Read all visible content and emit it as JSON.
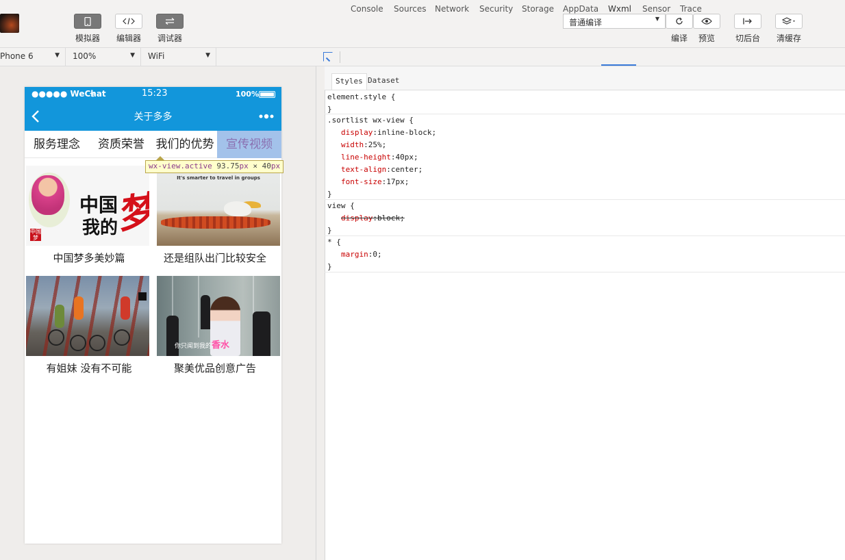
{
  "toolbar": {
    "simulator_label": "模拟器",
    "editor_label": "编辑器",
    "debugger_label": "调试器",
    "compile_mode": "普通编译",
    "compile_label": "编译",
    "preview_label": "预览",
    "background_label": "切后台",
    "clear_cache_label": "清缓存"
  },
  "device_bar": {
    "device": "Phone 6",
    "zoom": "100%",
    "network": "WiFi"
  },
  "devtools": {
    "tabs": [
      "Console",
      "Sources",
      "Network",
      "Security",
      "Storage",
      "AppData",
      "Wxml",
      "Sensor",
      "Trace"
    ],
    "active_tab": "Wxml",
    "subtabs": [
      "Styles",
      "Dataset"
    ],
    "active_subtab": "Styles",
    "rules": [
      {
        "selector": "element.style {",
        "close": "}",
        "props": []
      },
      {
        "selector": ".sortlist wx-view {",
        "close": "}",
        "props": [
          {
            "name": "display",
            "value": "inline-block;"
          },
          {
            "name": "width",
            "value": "25%;"
          },
          {
            "name": "line-height",
            "value": "40px;"
          },
          {
            "name": "text-align",
            "value": "center;"
          },
          {
            "name": "font-size",
            "value": "17px;"
          }
        ]
      },
      {
        "selector": "view {",
        "close": "}",
        "props": [
          {
            "name": "display",
            "value": "block;",
            "overridden": true
          }
        ]
      },
      {
        "selector": "* {",
        "close": "}",
        "props": [
          {
            "name": "margin",
            "value": "0;"
          }
        ]
      }
    ]
  },
  "phone": {
    "carrier": "●●●●● WeChat",
    "time": "15:23",
    "battery": "100%",
    "nav_title": "关于多多",
    "tabs": [
      "服务理念",
      "资质荣誉",
      "我们的优势",
      "宣传视频"
    ],
    "active_tab_index": 3,
    "tooltip_selector": "wx-view.active",
    "tooltip_size": "93.75",
    "tooltip_unit": "px",
    "tooltip_times": "×",
    "tooltip_height": "40",
    "cards": [
      {
        "caption": "中国梦多美妙篇",
        "img_text_1": "中国",
        "img_text_2": "我的",
        "img_text_3": "梦",
        "seal": "中国梦"
      },
      {
        "caption": "还是组队出门比较安全",
        "img_text_1": "It's smarter to travel in groups"
      },
      {
        "caption": "有姐妹 没有不可能"
      },
      {
        "caption": "聚美优品创意广告",
        "img_text_1": "你只闻到我的",
        "img_text_2": "香水"
      }
    ]
  },
  "colors": {
    "wechat_blue": "#1296db",
    "active_tab_bg": "#a3c2ea",
    "devtools_accent": "#3879d9",
    "css_prop_name": "#c80000"
  },
  "icons": [
    "avatar-image",
    "phone-icon",
    "code-icon",
    "debug-icon",
    "refresh-icon",
    "eye-icon",
    "switch-background-icon",
    "layers-icon",
    "inspect-icon",
    "back-arrow-icon",
    "more-dots-icon",
    "wifi-icon",
    "battery-icon"
  ]
}
